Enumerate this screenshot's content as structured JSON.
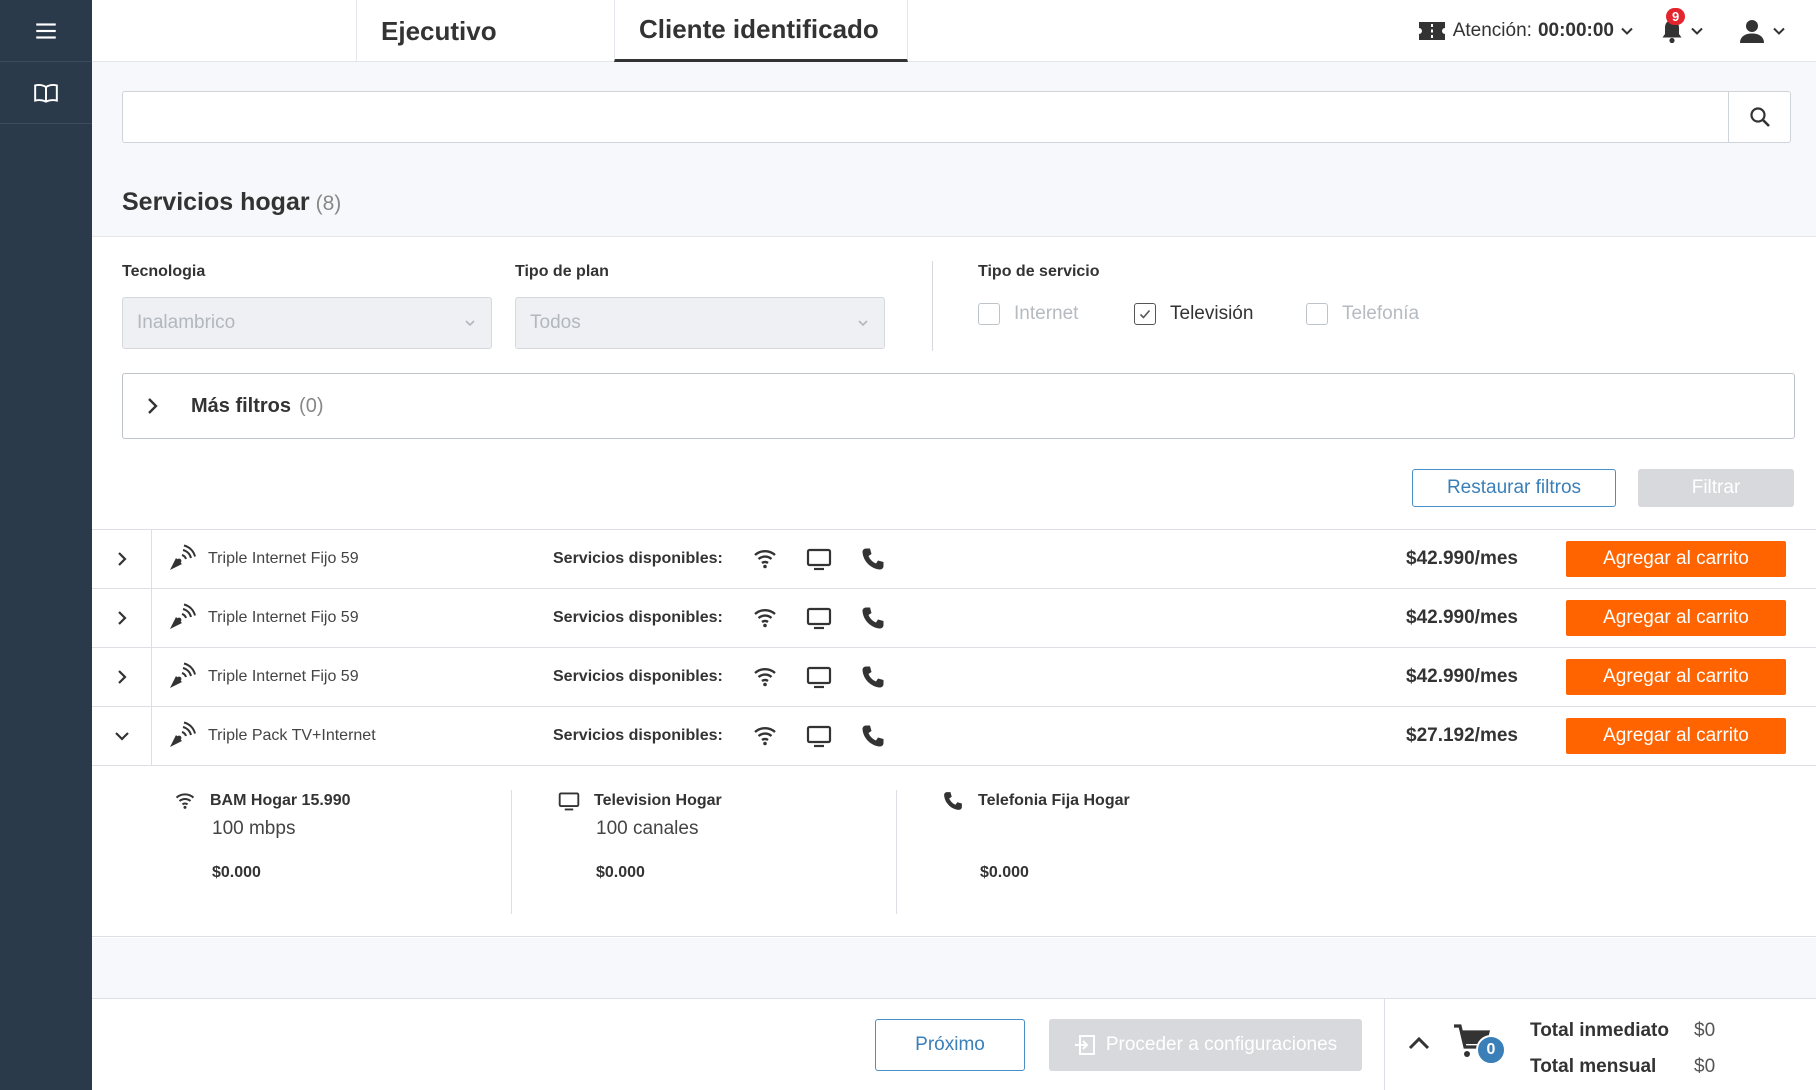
{
  "rail": {
    "menu_icon": "hamburger-menu-icon",
    "book_icon": "book-open-icon"
  },
  "tabs": [
    {
      "label": "Ejecutivo"
    },
    {
      "label": "Cliente identificado"
    }
  ],
  "header": {
    "attention_label": "Atención:",
    "attention_time": "00:00:00",
    "notifications_count": "9"
  },
  "search": {
    "value": "",
    "placeholder": ""
  },
  "section": {
    "title": "Servicios hogar",
    "count": "(8)"
  },
  "filters": {
    "tecnologia_label": "Tecnologia",
    "tecnologia_value": "Inalambrico",
    "tipo_plan_label": "Tipo de plan",
    "tipo_plan_value": "Todos",
    "tipo_servicio_label": "Tipo de servicio",
    "checkboxes": [
      {
        "label": "Internet",
        "checked": false
      },
      {
        "label": "Televisión",
        "checked": true
      },
      {
        "label": "Telefonía",
        "checked": false
      }
    ],
    "mas_filtros_label": "Más filtros",
    "mas_filtros_count": "(0)",
    "restaurar_label": "Restaurar filtros",
    "filtrar_label": "Filtrar"
  },
  "plans": [
    {
      "name": "Triple Internet Fijo 59",
      "services_label": "Servicios disponibles:",
      "price": "$42.990/mes",
      "cta": "Agregar al carrito",
      "expanded": false
    },
    {
      "name": "Triple Internet Fijo 59",
      "services_label": "Servicios disponibles:",
      "price": "$42.990/mes",
      "cta": "Agregar al carrito",
      "expanded": false
    },
    {
      "name": "Triple Internet Fijo 59",
      "services_label": "Servicios disponibles:",
      "price": "$42.990/mes",
      "cta": "Agregar al carrito",
      "expanded": false
    },
    {
      "name": "Triple Pack TV+Internet",
      "services_label": "Servicios disponibles:",
      "price": "$27.192/mes",
      "cta": "Agregar al carrito",
      "expanded": true
    }
  ],
  "plan_detail": [
    {
      "icon": "wifi-icon",
      "title": "BAM Hogar 15.990",
      "subtitle": "100 mbps",
      "price": "$0.000"
    },
    {
      "icon": "tv-icon",
      "title": "Television Hogar",
      "subtitle": "100 canales",
      "price": "$0.000"
    },
    {
      "icon": "phone-icon",
      "title": "Telefonia Fija Hogar",
      "subtitle": "",
      "price": "$0.000"
    }
  ],
  "footer": {
    "next_label": "Próximo",
    "proceed_label": "Proceder a configuraciones",
    "cart_count": "0",
    "total_inmediato_label": "Total inmediato",
    "total_inmediato_value": "$0",
    "total_mensual_label": "Total mensual",
    "total_mensual_value": "$0"
  },
  "colors": {
    "rail": "#2b3a4b",
    "accent_orange": "#ff6400",
    "link_blue": "#3a7fb8",
    "badge_red": "#e3262e"
  }
}
